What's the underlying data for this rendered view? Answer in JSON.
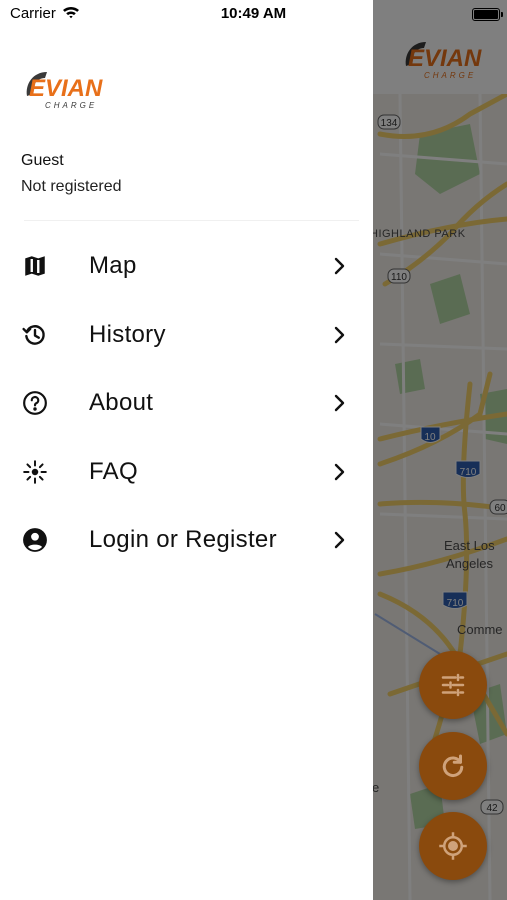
{
  "status_bar": {
    "carrier": "Carrier",
    "time": "10:49 AM"
  },
  "brand": {
    "logo_text": "EVIAN",
    "logo_sub": "CHARGE",
    "accent": "#e8701a",
    "logo_dark": "#3a3a3a"
  },
  "user": {
    "name": "Guest",
    "status": "Not registered"
  },
  "menu": {
    "items": [
      {
        "label": "Map",
        "icon": "map-icon"
      },
      {
        "label": "History",
        "icon": "history-icon"
      },
      {
        "label": "About",
        "icon": "help-circle-icon"
      },
      {
        "label": "FAQ",
        "icon": "sparkle-icon"
      },
      {
        "label": "Login or Register",
        "icon": "account-circle-icon"
      }
    ]
  },
  "map": {
    "labels": {
      "highland_park": "HIGHLAND PARK",
      "east_los_1": "East Los",
      "east_los_2": "Angeles",
      "commerce": "Comme",
      "partial_e": "e"
    },
    "shields": {
      "r134": "134",
      "r110": "110",
      "i10": "10",
      "i710a": "710",
      "r60": "60",
      "i710b": "710",
      "r42": "42"
    }
  },
  "fabs": [
    {
      "name": "filter-fab",
      "icon": "tune-icon"
    },
    {
      "name": "refresh-fab",
      "icon": "refresh-icon"
    },
    {
      "name": "locate-fab",
      "icon": "crosshair-icon"
    }
  ]
}
